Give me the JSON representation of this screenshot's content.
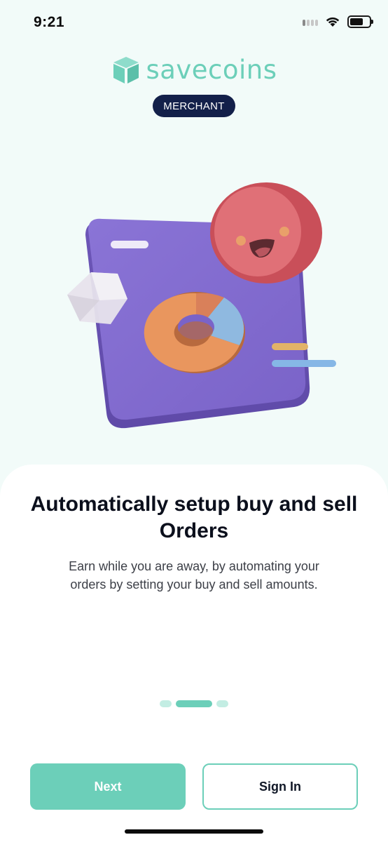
{
  "status_bar": {
    "time": "9:21"
  },
  "brand": {
    "name": "savecoins",
    "badge": "MERCHANT",
    "accent_color": "#6ccfb9",
    "badge_color": "#13204a"
  },
  "illustration": {
    "name": "3d-card-with-smiley-donut-chart"
  },
  "onboarding": {
    "title": "Automatically setup buy and sell Orders",
    "description": "Earn while you are away, by automating your orders by setting your buy and sell amounts.",
    "page_count": 3,
    "current_page": 2
  },
  "actions": {
    "next_label": "Next",
    "signin_label": "Sign In"
  },
  "icons": [
    "signal-icon",
    "wifi-icon",
    "battery-icon",
    "savecoins-logo-icon"
  ]
}
